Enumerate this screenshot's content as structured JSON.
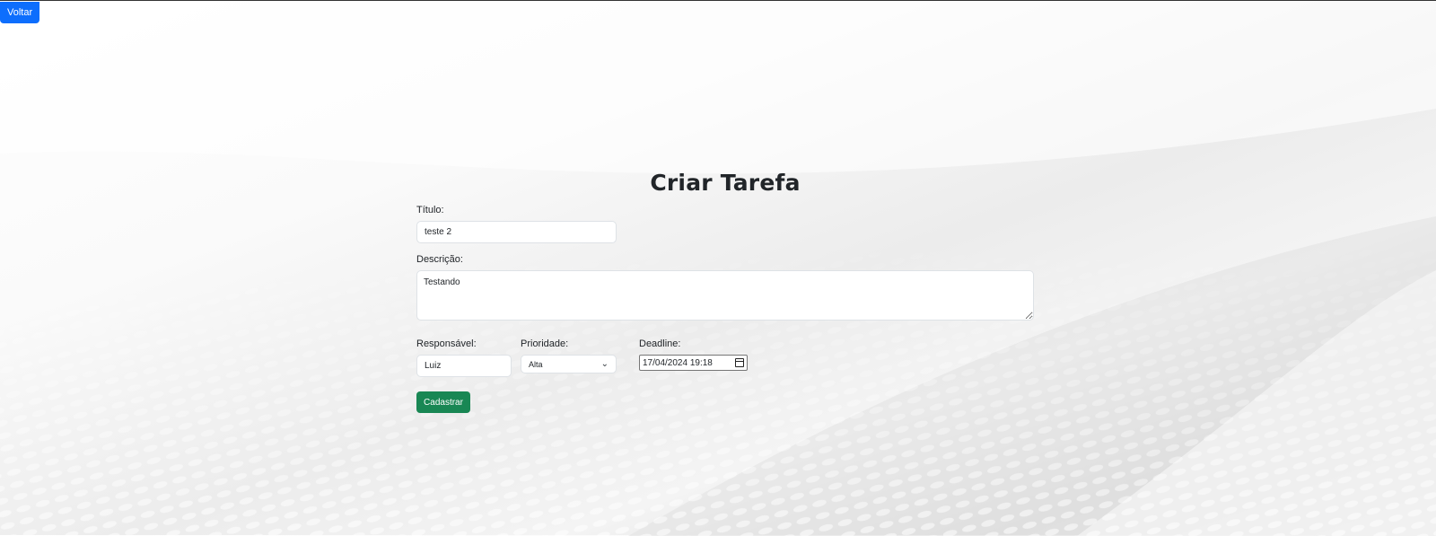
{
  "nav": {
    "back_label": "Voltar"
  },
  "form": {
    "heading": "Criar Tarefa",
    "titulo": {
      "label": "Título:",
      "value": "teste 2"
    },
    "descricao": {
      "label": "Descrição:",
      "value": "Testando"
    },
    "responsavel": {
      "label": "Responsável:",
      "value": "Luiz"
    },
    "prioridade": {
      "label": "Prioridade:",
      "selected": "Alta"
    },
    "deadline": {
      "label": "Deadline:",
      "value": "17/04/2024 19:18"
    },
    "submit_label": "Cadastrar"
  },
  "colors": {
    "primary": "#0d6efd",
    "success": "#198754"
  }
}
